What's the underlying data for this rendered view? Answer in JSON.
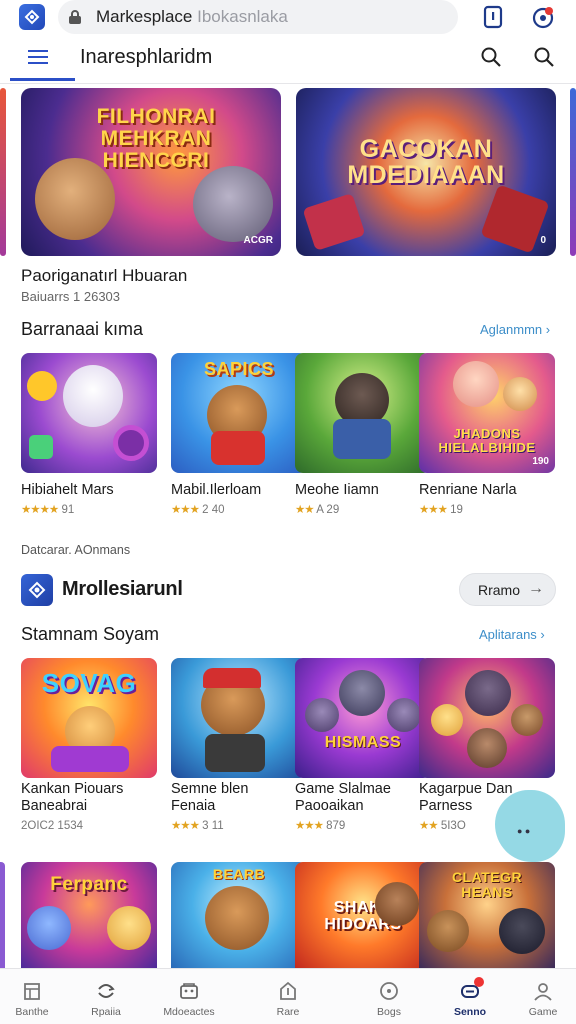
{
  "browser": {
    "url_main": "Markesplace",
    "url_dim": "Ibokasnlaka"
  },
  "nav": {
    "title": "Inaresphlaridm"
  },
  "featured": {
    "banners": [
      {
        "title": "FILHONRAI\nMEHKRAN\nHIENCGRI",
        "corner": "ACGR"
      },
      {
        "title": "GACOKAN\nMDEDIAAAN",
        "corner": "0"
      }
    ],
    "title": "Paoriganatırl Hbuaran",
    "subtitle": "Baiuarrs 1 26303"
  },
  "section1": {
    "title": "Barranaai kıma",
    "link": "Aglanmmn",
    "games": [
      {
        "thumb_text": "",
        "name": "Hibiahelt Mars",
        "stars": "★★★★",
        "rating": "91"
      },
      {
        "thumb_text": "SAPICS",
        "name": "Mabil.Ilerloam",
        "stars": "★★★",
        "rating": "2 40"
      },
      {
        "thumb_text": "",
        "name": "Meohe Iiamn",
        "stars": "★★",
        "rating": "A 29"
      },
      {
        "thumb_text": "JHADONS\nHIELALBIHIDE",
        "thumb_corner": "190",
        "name": "Renriane Narla",
        "stars": "★★★",
        "rating": "19"
      }
    ]
  },
  "caption": "Datcarar. AOnmans",
  "developer": {
    "name": "Mrollesiarunl",
    "button": "Rramo",
    "arrow": "→"
  },
  "section2": {
    "title": "Stamnam Soyam",
    "link": "Aplitarans",
    "games": [
      {
        "thumb_text": "SOVAG",
        "name": "Kankan Piouars\nBaneabrai",
        "stars": "",
        "rating": "2OIC2 1534"
      },
      {
        "thumb_text": "",
        "name": "Semne blen\nFenaia",
        "stars": "★★★",
        "rating": "3 11"
      },
      {
        "thumb_text": "HISMASS",
        "name": "Game Slalmae\nPaooaikan",
        "stars": "★★★",
        "rating": "879"
      },
      {
        "thumb_text": "",
        "name": "Kagarpue Dan\nParness",
        "stars": "★★",
        "rating": "5I3O"
      }
    ]
  },
  "section3": {
    "thumbs": [
      {
        "thumb_text": "Ferpanc"
      },
      {
        "thumb_text": "BEARB"
      },
      {
        "thumb_text": "SHAKE\nHIDOARS"
      },
      {
        "thumb_text": "CLATEGR\nHEANS"
      }
    ]
  },
  "bottom_nav": [
    {
      "label": "Banthe",
      "icon": "home-icon"
    },
    {
      "label": "Rpaiia",
      "icon": "swap-icon"
    },
    {
      "label": "Mdoeactes",
      "icon": "gallery-icon"
    },
    {
      "label": "Rare",
      "icon": "upload-icon"
    },
    {
      "label": "Bogs",
      "icon": "compass-icon"
    },
    {
      "label": "Senno",
      "icon": "gamepad-icon",
      "active": true
    },
    {
      "label": "Game",
      "icon": "profile-icon"
    }
  ]
}
